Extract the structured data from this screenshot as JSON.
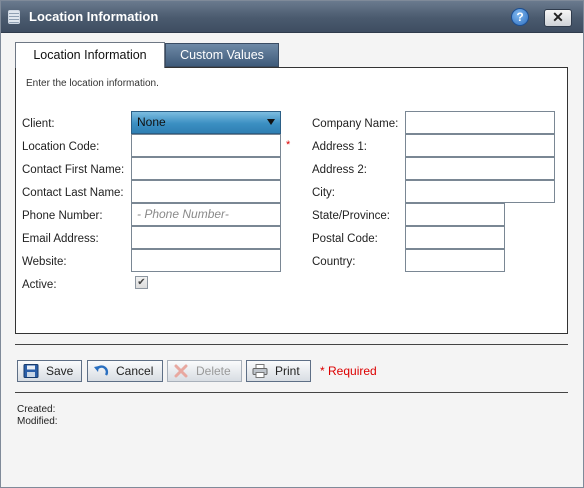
{
  "window": {
    "title": "Location Information",
    "help_label": "?",
    "close_label": "✕"
  },
  "tabs": [
    {
      "label": "Location Information",
      "active": true
    },
    {
      "label": "Custom Values",
      "active": false
    }
  ],
  "instructions": "Enter the location information.",
  "form": {
    "client": {
      "label": "Client:",
      "value": "None"
    },
    "location_code": {
      "label": "Location Code:",
      "value": "",
      "required_marker": "*"
    },
    "contact_first_name": {
      "label": "Contact First Name:",
      "value": ""
    },
    "contact_last_name": {
      "label": "Contact Last Name:",
      "value": ""
    },
    "phone_number": {
      "label": "Phone Number:",
      "value": "",
      "placeholder": "- Phone Number-"
    },
    "email_address": {
      "label": "Email Address:",
      "value": ""
    },
    "website": {
      "label": "Website:",
      "value": ""
    },
    "active": {
      "label": "Active:",
      "checked": true,
      "check_glyph": "✔"
    },
    "company_name": {
      "label": "Company Name:",
      "value": ""
    },
    "address_1": {
      "label": "Address 1:",
      "value": ""
    },
    "address_2": {
      "label": "Address 2:",
      "value": ""
    },
    "city": {
      "label": "City:",
      "value": ""
    },
    "state_province": {
      "label": "State/Province:",
      "value": ""
    },
    "postal_code": {
      "label": "Postal Code:",
      "value": ""
    },
    "country": {
      "label": "Country:",
      "value": ""
    }
  },
  "buttons": [
    {
      "label": "Save",
      "icon": "floppy-disk-icon",
      "enabled": true
    },
    {
      "label": "Cancel",
      "icon": "undo-arrow-icon",
      "enabled": true
    },
    {
      "label": "Delete",
      "icon": "delete-x-icon",
      "enabled": false
    },
    {
      "label": "Print",
      "icon": "printer-icon",
      "enabled": true
    }
  ],
  "required_note": "* Required",
  "meta": {
    "created_label": "Created:",
    "modified_label": "Modified:"
  },
  "colors": {
    "titlebar": "#4a5a6e",
    "select_accent": "#3b8fc2",
    "required": "#dd0000"
  }
}
